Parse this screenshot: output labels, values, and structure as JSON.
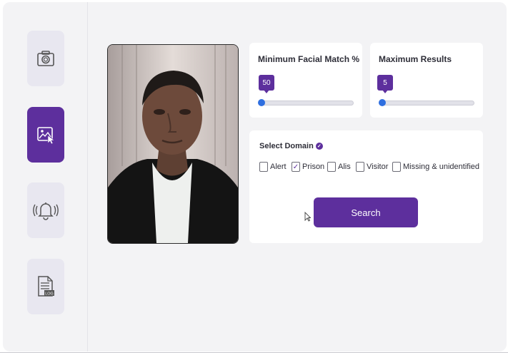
{
  "sidebar": {
    "items": [
      {
        "icon": "camera-icon",
        "active": false
      },
      {
        "icon": "image-upload-icon",
        "active": true
      },
      {
        "icon": "alert-bell-icon",
        "active": false
      },
      {
        "icon": "log-file-icon",
        "active": false,
        "badge": "LOG"
      }
    ]
  },
  "min_match": {
    "title": "Minimum Facial Match %",
    "value": "50",
    "level_fraction": 0.0
  },
  "max_results": {
    "title": "Maximum Results",
    "value": "5",
    "level_fraction": 0.0
  },
  "domain": {
    "title": "Select Domain",
    "options": [
      {
        "label": "Alert",
        "checked": false
      },
      {
        "label": "Prison",
        "checked": true
      },
      {
        "label": "Alis",
        "checked": false
      },
      {
        "label": "Visitor",
        "checked": false
      },
      {
        "label": "Missing & unidentified",
        "checked": false
      }
    ]
  },
  "search_label": "Search",
  "colors": {
    "accent": "#5d2f9d",
    "slider_thumb": "#2f6fe0",
    "background": "#f3f3f5",
    "card": "#ffffff"
  }
}
